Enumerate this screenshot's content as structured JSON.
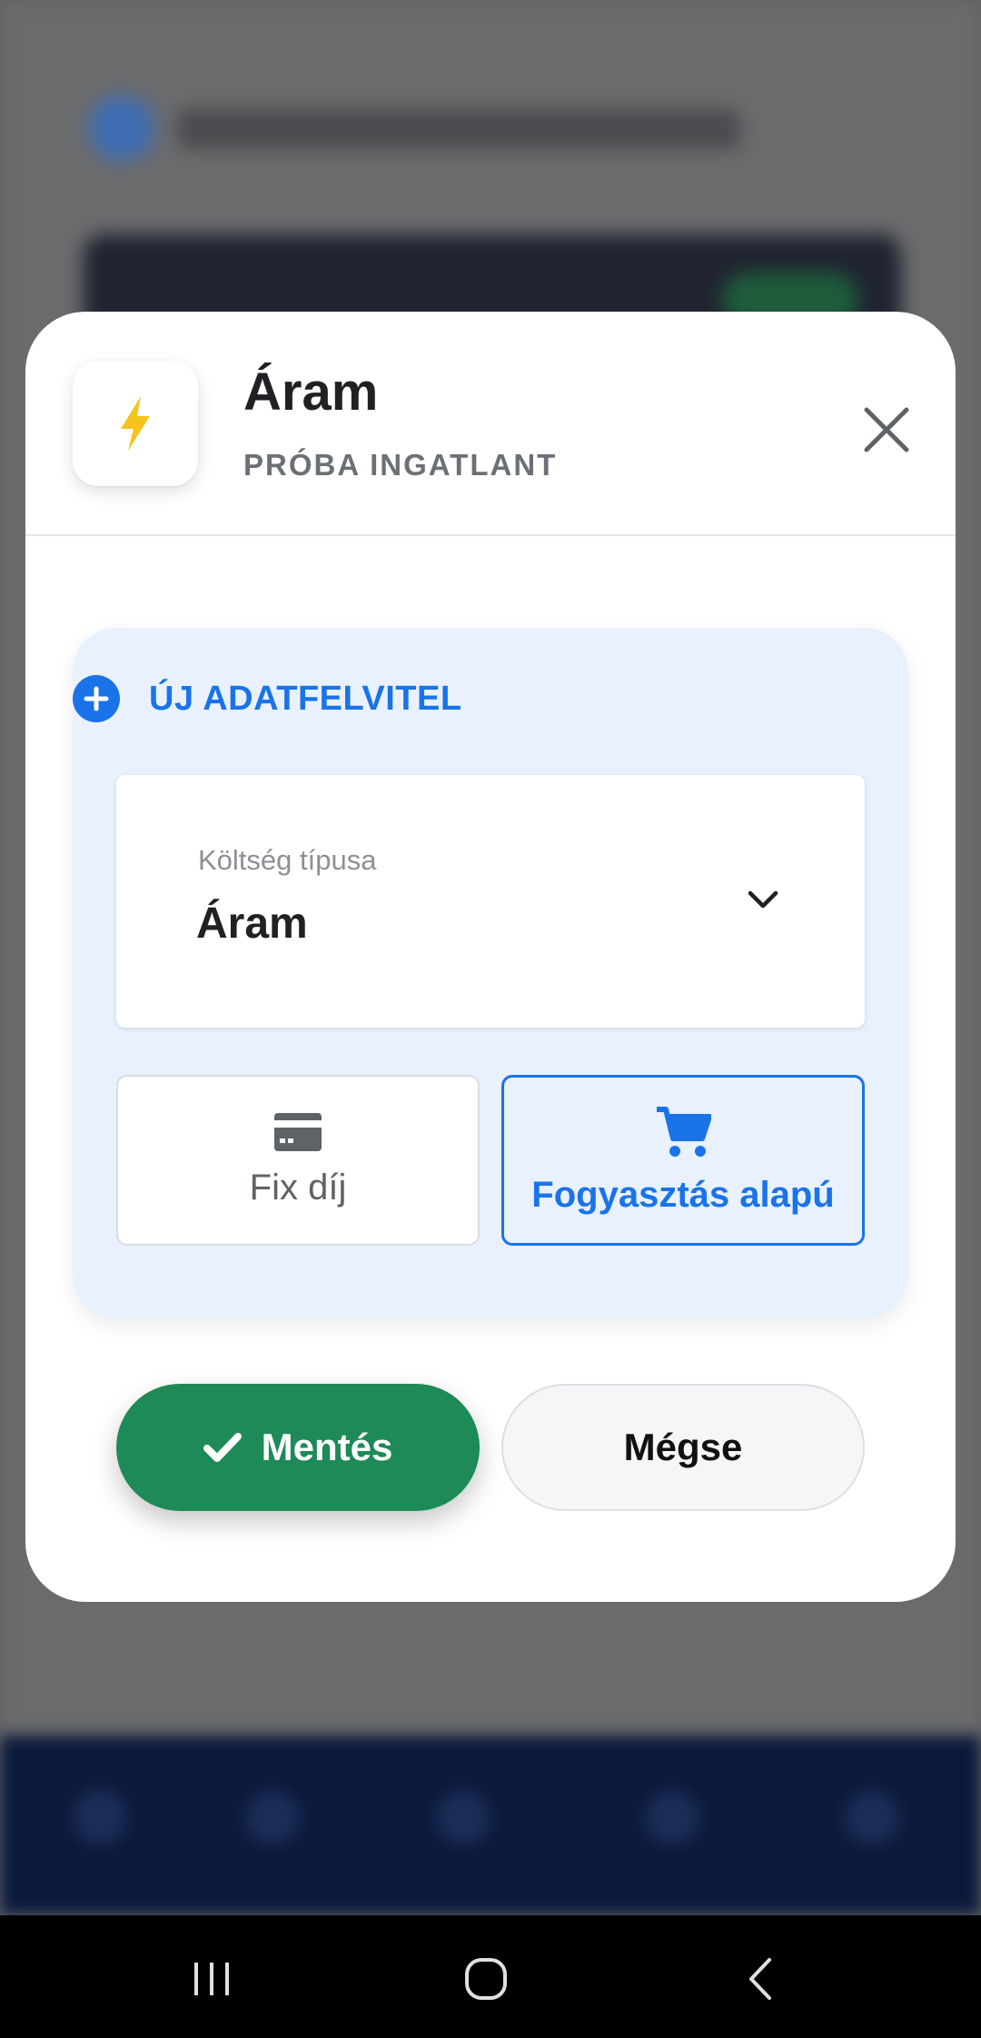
{
  "modal": {
    "title": "Áram",
    "subtitle": "PRÓBA INGATLANT",
    "header_icon": "lightning-bolt-icon",
    "close_icon": "close-icon"
  },
  "entry": {
    "heading": "ÚJ ADATFELVITEL",
    "heading_icon": "plus-circle-icon",
    "cost_type_label": "Költség típusa",
    "cost_type_value": "Áram",
    "options": [
      {
        "label": "Fix díj",
        "icon": "payment-card-icon",
        "selected": false
      },
      {
        "label": "Fogyasztás alapú",
        "icon": "shopping-cart-icon",
        "selected": true
      }
    ]
  },
  "actions": {
    "save_label": "Mentés",
    "save_icon": "checkmark-icon",
    "cancel_label": "Mégse"
  },
  "system_nav": {
    "recents_icon": "recents-icon",
    "home_icon": "home-icon",
    "back_icon": "back-icon"
  },
  "colors": {
    "accent": "#1a73e8",
    "save": "#1e8a57",
    "bolt": "#f6c31c",
    "card_bg": "#e8f1fd"
  }
}
